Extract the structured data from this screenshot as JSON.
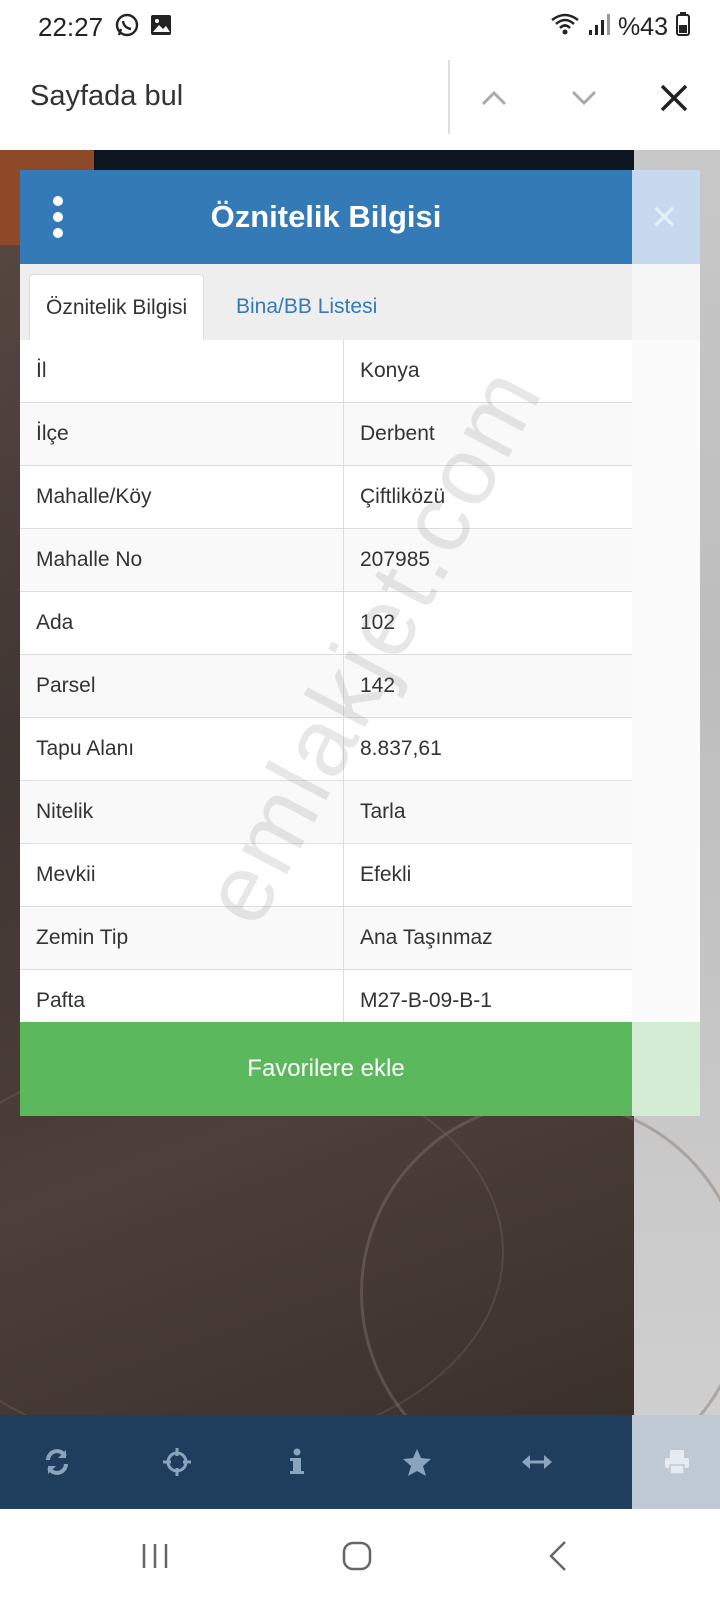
{
  "status_bar": {
    "time": "22:27",
    "battery": "%43"
  },
  "find_bar": {
    "label": "Sayfada bul"
  },
  "dialog": {
    "title": "Öznitelik Bilgisi",
    "tabs": [
      {
        "label": "Öznitelik Bilgisi",
        "active": true
      },
      {
        "label": "Bina/BB Listesi",
        "active": false
      }
    ],
    "rows": [
      {
        "key": "İl",
        "value": "Konya"
      },
      {
        "key": "İlçe",
        "value": "Derbent"
      },
      {
        "key": "Mahalle/Köy",
        "value": "Çiftliközü"
      },
      {
        "key": "Mahalle No",
        "value": "207985"
      },
      {
        "key": "Ada",
        "value": "102"
      },
      {
        "key": "Parsel",
        "value": "142"
      },
      {
        "key": "Tapu Alanı",
        "value": "8.837,61"
      },
      {
        "key": "Nitelik",
        "value": "Tarla"
      },
      {
        "key": "Mevkii",
        "value": "Efekli"
      },
      {
        "key": "Zemin Tip",
        "value": "Ana Taşınmaz"
      },
      {
        "key": "Pafta",
        "value": "M27-B-09-B-1"
      }
    ],
    "favorite_button": "Favorilere ekle"
  },
  "watermark": "emlakjet.com",
  "toolbar": {
    "icons": [
      "refresh-icon",
      "crosshair-icon",
      "info-icon",
      "star-icon",
      "measure-icon",
      "print-icon"
    ]
  },
  "colors": {
    "header_blue": "#337ab7",
    "favorite_green": "#5cb85c",
    "toolbar_navy": "#1f3d5c"
  }
}
